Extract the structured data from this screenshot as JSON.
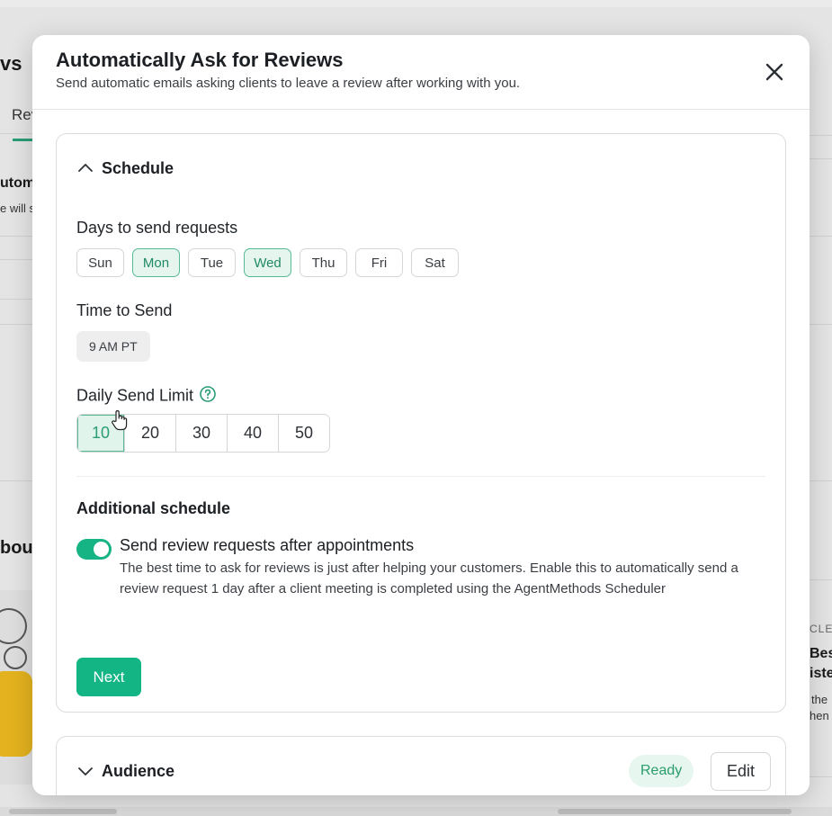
{
  "background": {
    "page_title_fragment": "vs",
    "tab_fragment": "Rev",
    "row_heading_fragment": "utom",
    "row_text_fragment": "e will s",
    "section_fragment": "bou",
    "article_label_fragment": "CLE",
    "article_title_line1": "Best",
    "article_title_line2": "iste",
    "article_text_line1": "the",
    "article_text_line2": "hen"
  },
  "modal": {
    "title": "Automatically Ask for Reviews",
    "subtitle": "Send automatic emails asking clients to leave a review after working with you.",
    "close_icon": "close-icon"
  },
  "schedule": {
    "section_title": "Schedule",
    "days_label": "Days to send requests",
    "days": [
      {
        "label": "Sun",
        "selected": false
      },
      {
        "label": "Mon",
        "selected": true
      },
      {
        "label": "Tue",
        "selected": false
      },
      {
        "label": "Wed",
        "selected": true
      },
      {
        "label": "Thu",
        "selected": false
      },
      {
        "label": "Fri",
        "selected": false
      },
      {
        "label": "Sat",
        "selected": false
      }
    ],
    "time_label": "Time to Send",
    "time_value": "9 AM PT",
    "limit_label": "Daily Send Limit",
    "limits": [
      {
        "label": "10",
        "selected": true
      },
      {
        "label": "20",
        "selected": false
      },
      {
        "label": "30",
        "selected": false
      },
      {
        "label": "40",
        "selected": false
      },
      {
        "label": "50",
        "selected": false
      }
    ],
    "additional_heading": "Additional schedule",
    "toggle_on": true,
    "toggle_title": "Send review requests after appointments",
    "toggle_description": "The best time to ask for reviews is just after helping your customers. Enable this to automatically send a review request 1 day after a client meeting is completed using the AgentMethods Scheduler",
    "next_label": "Next"
  },
  "audience": {
    "section_title": "Audience",
    "status": "Ready",
    "edit_label": "Edit"
  },
  "colors": {
    "accent": "#14b585",
    "selected_bg": "#e6f6ef",
    "selected_border": "#58b995",
    "ready_bg": "#e7f6ee",
    "ready_text": "#2a9d6d"
  }
}
